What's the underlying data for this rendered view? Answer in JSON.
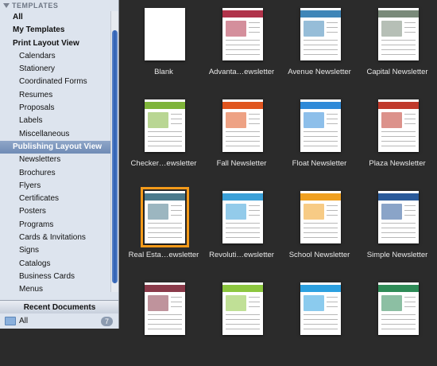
{
  "sidebar": {
    "header": "TEMPLATES",
    "items": [
      {
        "label": "All",
        "level": 0,
        "selected": false
      },
      {
        "label": "My Templates",
        "level": 0,
        "selected": false
      },
      {
        "label": "Print Layout View",
        "level": 0,
        "selected": false
      },
      {
        "label": "Calendars",
        "level": 1,
        "selected": false
      },
      {
        "label": "Stationery",
        "level": 1,
        "selected": false
      },
      {
        "label": "Coordinated Forms",
        "level": 1,
        "selected": false
      },
      {
        "label": "Resumes",
        "level": 1,
        "selected": false
      },
      {
        "label": "Proposals",
        "level": 1,
        "selected": false
      },
      {
        "label": "Labels",
        "level": 1,
        "selected": false
      },
      {
        "label": "Miscellaneous",
        "level": 1,
        "selected": false
      },
      {
        "label": "Publishing Layout View",
        "level": 0,
        "selected": true
      },
      {
        "label": "Newsletters",
        "level": 1,
        "selected": false
      },
      {
        "label": "Brochures",
        "level": 1,
        "selected": false
      },
      {
        "label": "Flyers",
        "level": 1,
        "selected": false
      },
      {
        "label": "Certificates",
        "level": 1,
        "selected": false
      },
      {
        "label": "Posters",
        "level": 1,
        "selected": false
      },
      {
        "label": "Programs",
        "level": 1,
        "selected": false
      },
      {
        "label": "Cards & Invitations",
        "level": 1,
        "selected": false
      },
      {
        "label": "Signs",
        "level": 1,
        "selected": false
      },
      {
        "label": "Catalogs",
        "level": 1,
        "selected": false
      },
      {
        "label": "Business Cards",
        "level": 1,
        "selected": false
      },
      {
        "label": "Menus",
        "level": 1,
        "selected": false
      }
    ],
    "recent_header": "Recent Documents",
    "recent_all_label": "All",
    "recent_all_count": "7"
  },
  "templates": [
    {
      "name": "Blank",
      "accent": "#ffffff",
      "selected": false
    },
    {
      "name": "Advanta…ewsletter",
      "accent": "#b0334a",
      "selected": false
    },
    {
      "name": "Avenue Newsletter",
      "accent": "#3f86b8",
      "selected": false
    },
    {
      "name": "Capital Newsletter",
      "accent": "#7a8a7a",
      "selected": false
    },
    {
      "name": "Checker…ewsletter",
      "accent": "#7fb43a",
      "selected": false
    },
    {
      "name": "Fall Newsletter",
      "accent": "#e0551f",
      "selected": false
    },
    {
      "name": "Float Newsletter",
      "accent": "#2f8ad8",
      "selected": false
    },
    {
      "name": "Plaza Newsletter",
      "accent": "#c0392b",
      "selected": false
    },
    {
      "name": "Real Esta…ewsletter",
      "accent": "#4b7a8c",
      "selected": true
    },
    {
      "name": "Revoluti…ewsletter",
      "accent": "#3aa0d8",
      "selected": false
    },
    {
      "name": "School Newsletter",
      "accent": "#f0a020",
      "selected": false
    },
    {
      "name": "Simple Newsletter",
      "accent": "#2a5a9a",
      "selected": false
    },
    {
      "name": "",
      "accent": "#8a3a4a",
      "selected": false
    },
    {
      "name": "",
      "accent": "#8cc63f",
      "selected": false
    },
    {
      "name": "",
      "accent": "#2ca0e0",
      "selected": false
    },
    {
      "name": "",
      "accent": "#2e8b57",
      "selected": false
    }
  ]
}
